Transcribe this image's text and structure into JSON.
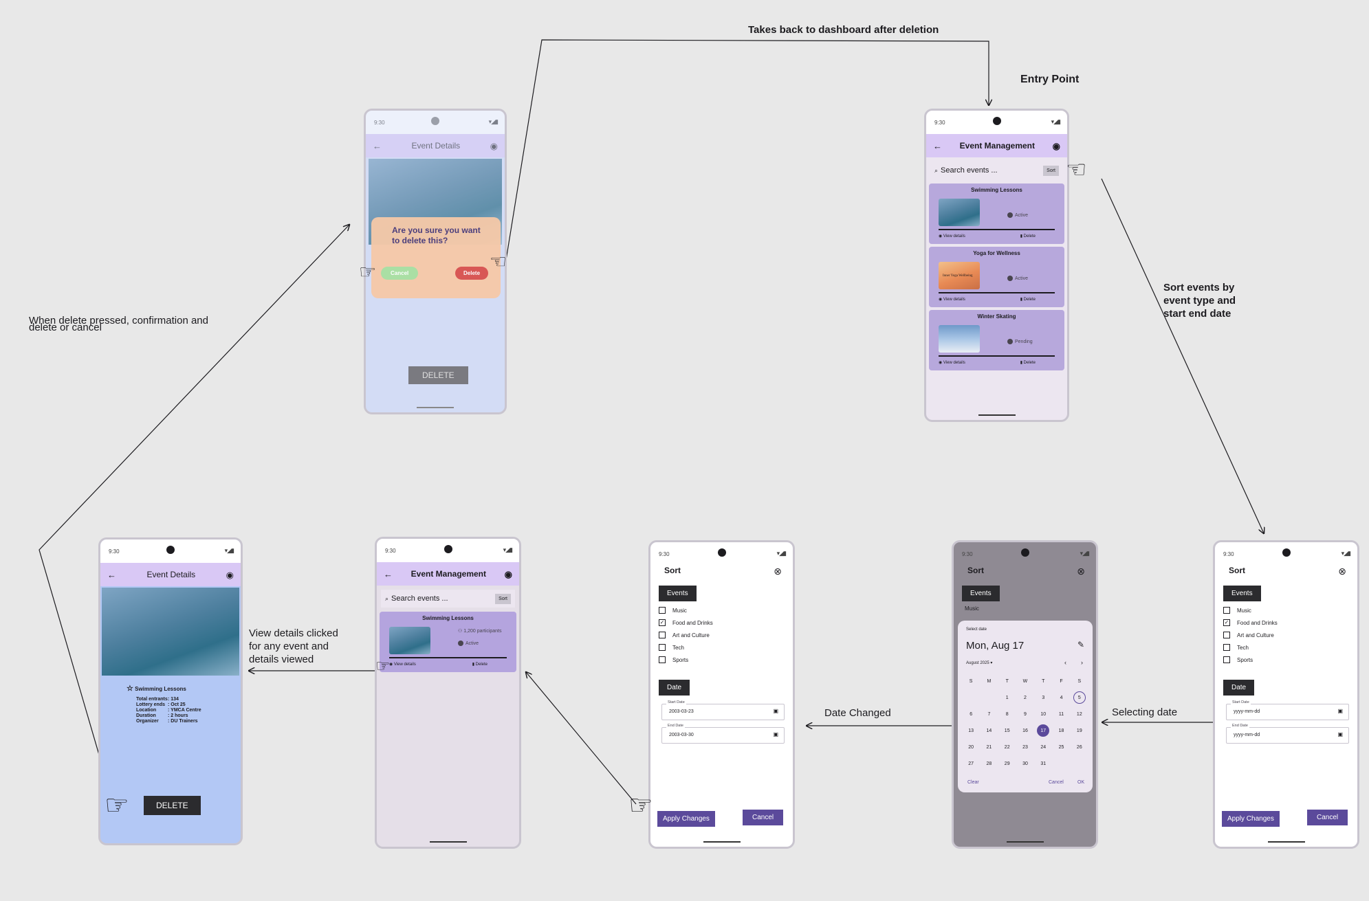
{
  "annotations": {
    "takes_back": "Takes back to dashboard after deletion",
    "entry_point": "Entry Point",
    "sort_events": [
      "Sort events by",
      "event type and",
      "start end date"
    ],
    "delete_confirm": [
      "When delete pressed, confirmation and",
      "delete or cancel"
    ],
    "view_details": [
      "View details clicked",
      "for any event and",
      "details viewed"
    ],
    "date_changed": "Date Changed",
    "selecting_date": "Selecting date"
  },
  "status": {
    "time": "9:30",
    "signal": "▾◢▮"
  },
  "icons": {
    "back": "←",
    "profile": "◉",
    "search": "🔍",
    "close": "⊗",
    "hand": "☞",
    "star": "☆",
    "eye": "◉",
    "trash": "🗑",
    "pencil": "✎",
    "calendar": "▣",
    "people": "👥"
  },
  "dashboard": {
    "title": "Event Management",
    "search_placeholder": "Search events ...",
    "sort_label": "Sort",
    "view_details": "View details",
    "delete": "Delete",
    "cards": [
      {
        "title": "Swimming Lessons",
        "status": "Active"
      },
      {
        "title": "Yoga for Wellness",
        "status": "Active"
      },
      {
        "title": "Winter Skating",
        "status": "Pending"
      }
    ],
    "yoga_image_text": "Inner Yoga Wellbeing"
  },
  "filtered": {
    "title": "Event Management",
    "search_placeholder": "Search events ...",
    "sort_label": "Sort",
    "card_title": "Swimming Lessons",
    "participants": "1,200 participants",
    "status": "Active",
    "view_details": "View details",
    "delete": "Delete"
  },
  "details": {
    "title": "Event Details",
    "event_name": "Swimming Lessons",
    "rows": [
      {
        "k": "Total entrants",
        "v": ": 134"
      },
      {
        "k": "Lottery ends",
        "v": ": Oct 25"
      },
      {
        "k": "Location",
        "v": ": YMCA Centre"
      },
      {
        "k": "Duration",
        "v": ": 2 hours"
      },
      {
        "k": "Organizer",
        "v": ": DU Trainers"
      }
    ],
    "delete_button": "DELETE"
  },
  "confirm": {
    "title": "Event Details",
    "question": "Are you sure you want to delete this?",
    "cancel": "Cancel",
    "delete": "Delete",
    "delete_button": "DELETE"
  },
  "sort": {
    "title": "Sort",
    "events_label": "Events",
    "date_label": "Date",
    "categories": [
      "Music",
      "Food and Drinks",
      "Art and Culture",
      "Tech",
      "Sports"
    ],
    "checked_index": 1,
    "start_label": "Start Date",
    "end_label": "End Date",
    "placeholder": "yyyy-mm-dd",
    "start_value": "2003-03-23",
    "end_value": "2003-03-30",
    "apply": "Apply Changes",
    "cancel": "Cancel"
  },
  "datepicker": {
    "select_date": "Select date",
    "selected_text": "Mon, Aug 17",
    "month_label": "August 2025",
    "weekdays": [
      "S",
      "M",
      "T",
      "W",
      "T",
      "F",
      "S"
    ],
    "weeks": [
      [
        "",
        "",
        "1",
        "2",
        "3",
        "4",
        "5"
      ],
      [
        "6",
        "7",
        "8",
        "9",
        "10",
        "11",
        "12"
      ],
      [
        "13",
        "14",
        "15",
        "16",
        "17",
        "18",
        "19"
      ],
      [
        "20",
        "21",
        "22",
        "23",
        "24",
        "25",
        "26"
      ],
      [
        "27",
        "28",
        "29",
        "30",
        "31",
        "",
        ""
      ]
    ],
    "selected_day": "17",
    "today_day": "5",
    "clear": "Clear",
    "cancel": "Cancel",
    "ok": "OK",
    "partial_item": "Music"
  },
  "colors": {
    "accent": "#5b4a9b",
    "appbar": "#d9c8f5",
    "card": "#b7a8dc",
    "details_bg": "#b3c8f5",
    "delete_red": "#d9504d",
    "cancel_green": "#a8e0a0"
  }
}
